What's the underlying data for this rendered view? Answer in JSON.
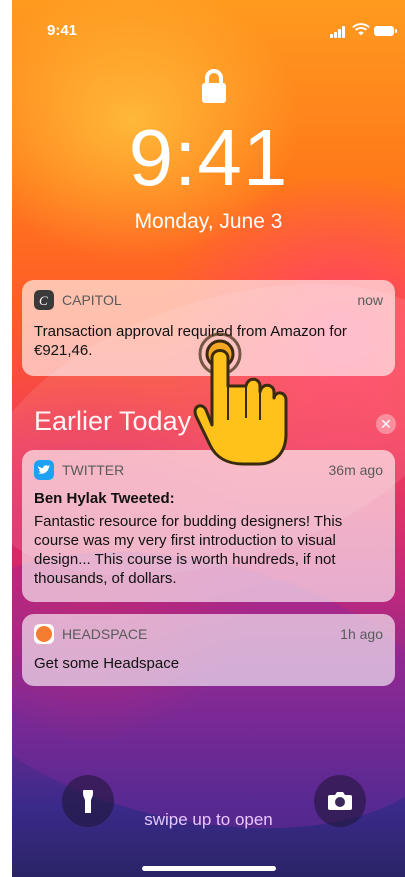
{
  "status_bar": {
    "time": "9:41"
  },
  "lock_screen": {
    "time": "9:41",
    "date": "Monday, June 3"
  },
  "notifications": [
    {
      "app": "CAPITOL",
      "when": "now",
      "icon": "capitol-app-icon",
      "body": "Transaction approval required from Amazon for €921,46."
    }
  ],
  "earlier_today": {
    "heading": "Earlier Today",
    "clear_icon": "close-icon",
    "items": [
      {
        "app": "TWITTER",
        "when": "36m ago",
        "icon": "twitter-app-icon",
        "title": "Ben Hylak Tweeted:",
        "body": "Fantastic resource for budding designers! This course was my very first introduction to visual design... This course is worth hundreds, if not thousands, of dollars."
      },
      {
        "app": "HEADSPACE",
        "when": "1h ago",
        "icon": "headspace-app-icon",
        "body": "Get some Headspace"
      }
    ]
  },
  "bottom": {
    "flashlight_icon": "flashlight-icon",
    "camera_icon": "camera-icon",
    "swipe_text": "swipe up to open"
  },
  "colors": {
    "twitter": "#1da1f2",
    "headspace": "#f47d31",
    "capitol": "#333333"
  },
  "overlay": {
    "icon": "tap-hand-icon"
  }
}
